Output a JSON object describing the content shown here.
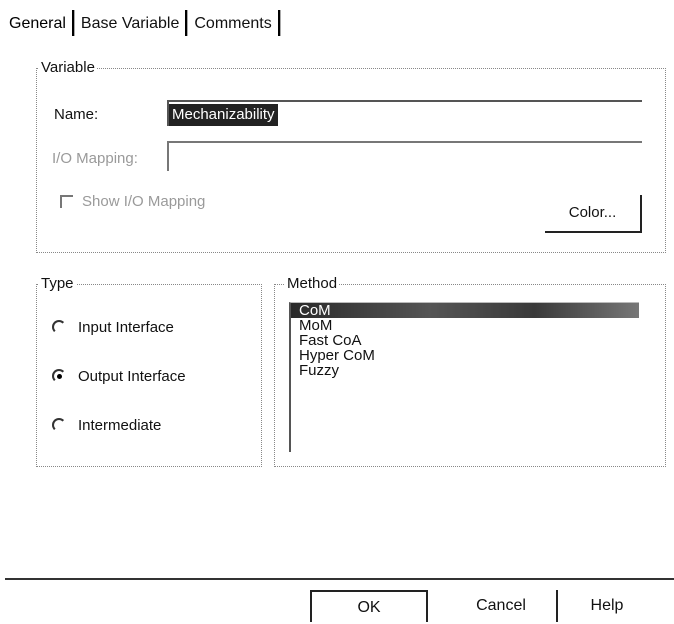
{
  "tabs": [
    {
      "label": "General",
      "active": true
    },
    {
      "label": "Base Variable",
      "active": false
    },
    {
      "label": "Comments",
      "active": false
    }
  ],
  "variable": {
    "legend": "Variable",
    "name_label": "Name:",
    "name_value": "Mechanizability",
    "io_label": "I/O Mapping:",
    "io_value": "",
    "show_io_label": "Show I/O Mapping",
    "show_io_checked": false,
    "color_button": "Color..."
  },
  "type": {
    "legend": "Type",
    "options": [
      {
        "label": "Input Interface",
        "checked": false
      },
      {
        "label": "Output Interface",
        "checked": true
      },
      {
        "label": "Intermediate",
        "checked": false
      }
    ]
  },
  "method": {
    "legend": "Method",
    "items": [
      "CoM",
      "MoM",
      "Fast CoA",
      "Hyper CoM",
      "Fuzzy"
    ],
    "selected_index": 0
  },
  "buttons": {
    "ok": "OK",
    "cancel": "Cancel",
    "help": "Help"
  }
}
